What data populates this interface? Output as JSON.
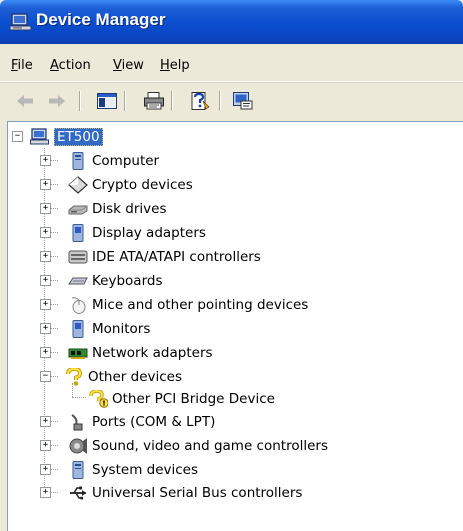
{
  "window": {
    "title": "Device Manager"
  },
  "menu": [
    {
      "label": "File",
      "mnemonic": "F",
      "rest": "ile"
    },
    {
      "label": "Action",
      "mnemonic": "A",
      "rest": "ction"
    },
    {
      "label": "View",
      "mnemonic": "V",
      "rest": "iew"
    },
    {
      "label": "Help",
      "mnemonic": "H",
      "rest": "elp"
    }
  ],
  "toolbar": {
    "icons": [
      "back-arrow-icon",
      "forward-arrow-icon",
      "show-hide-console-tree-icon",
      "print-icon",
      "help-icon",
      "properties-icon"
    ]
  },
  "tree": {
    "root": {
      "label": "ET500",
      "icon": "computer-icon",
      "expanded": true,
      "selected": true
    },
    "items": [
      {
        "label": "Computer",
        "icon": "computer-icon"
      },
      {
        "label": "Crypto devices",
        "icon": "diamond-icon"
      },
      {
        "label": "Disk drives",
        "icon": "disk-drive-icon"
      },
      {
        "label": "Display adapters",
        "icon": "monitor-icon"
      },
      {
        "label": "IDE ATA/ATAPI controllers",
        "icon": "ide-controller-icon"
      },
      {
        "label": "Keyboards",
        "icon": "keyboard-icon"
      },
      {
        "label": "Mice and other pointing devices",
        "icon": "mouse-icon"
      },
      {
        "label": "Monitors",
        "icon": "monitor-icon"
      },
      {
        "label": "Network adapters",
        "icon": "network-adapter-icon"
      },
      {
        "label": "Other devices",
        "icon": "unknown-device-icon",
        "expanded": true,
        "children": [
          {
            "label": "Other PCI Bridge Device",
            "icon": "warning-unknown-device-icon"
          }
        ]
      },
      {
        "label": "Ports (COM & LPT)",
        "icon": "port-icon"
      },
      {
        "label": "Sound, video and game controllers",
        "icon": "sound-icon"
      },
      {
        "label": "System devices",
        "icon": "computer-icon"
      },
      {
        "label": "Universal Serial Bus controllers",
        "icon": "usb-icon"
      }
    ]
  },
  "colors": {
    "titlebar": "#0b4fd1",
    "selection": "#316ac5",
    "chrome": "#ece9d8"
  }
}
